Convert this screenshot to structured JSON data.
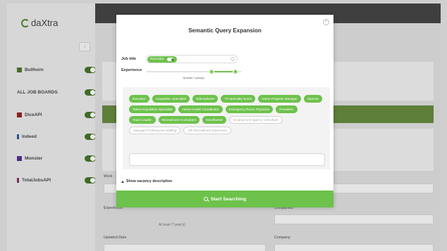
{
  "app": {
    "logo_text": "daXtra"
  },
  "sidebar": {
    "collapse_icon": "chevron-left-icon",
    "sources": [
      {
        "label": "Bullhorn",
        "icon": "bullhorn-icon",
        "icon_color": "#4b6b2a",
        "enabled": true
      },
      {
        "label": "ALL JOB BOARDS",
        "icon": "",
        "enabled": true
      },
      {
        "label": "DiceAPI",
        "icon": "dice-icon",
        "icon_color": "#8b1f1f",
        "enabled": true
      },
      {
        "label": "Indeed",
        "icon": "indeed-icon",
        "icon_color": "#2a4f9a",
        "enabled": true
      },
      {
        "label": "Monster",
        "icon": "monster-icon",
        "icon_color": "#4b2e83",
        "enabled": true
      },
      {
        "label": "TotalJobsAPI",
        "icon": "totaljobs-icon",
        "icon_color": "#7c2a5a",
        "enabled": true
      }
    ]
  },
  "background": {
    "labels": {
      "work": "Work",
      "experience": "Experience",
      "updated_date": "Updated Date",
      "company": "Company",
      "companies": "Companies",
      "experience_caption": "At least 7 year(s)"
    }
  },
  "modal": {
    "title": "Semantic Query Expansion",
    "job_title_label": "Job title",
    "job_title_value": "Recruiter",
    "experience_label": "Experience",
    "experience_caption": "At least 7 year(s)",
    "experience_range": [
      0.69,
      0.94
    ],
    "synonyms": [
      {
        "label": "Recruiter",
        "selected": true
      },
      {
        "label": "Acquisition Specialist",
        "selected": true
      },
      {
        "label": "Telemarketer",
        "selected": true
      },
      {
        "label": "Tri-Specialty Nurse",
        "selected": true
      },
      {
        "label": "Nurse Program Manager",
        "selected": true
      },
      {
        "label": "Sourcer",
        "selected": true
      },
      {
        "label": "Talent Acquisition Specialist",
        "selected": true
      },
      {
        "label": "Home Health Coordinator",
        "selected": true
      },
      {
        "label": "Emergency Room Physician",
        "selected": true
      },
      {
        "label": "President,",
        "selected": true
      },
      {
        "label": "Team Leader,",
        "selected": true
      },
      {
        "label": "Recruitment Consultant",
        "selected": true
      },
      {
        "label": "Headhunter",
        "selected": true
      },
      {
        "label": "Employment agency consultant",
        "selected": false
      },
      {
        "label": "Manager Professional Staffing",
        "selected": false
      },
      {
        "label": "HR Recruitment Supervisor",
        "selected": false
      }
    ],
    "show_description": "Show vacancy description",
    "start_button": "Start Searching"
  },
  "colors": {
    "accent": "#6dc24b",
    "overlay_dark": "#3f3f3f"
  }
}
